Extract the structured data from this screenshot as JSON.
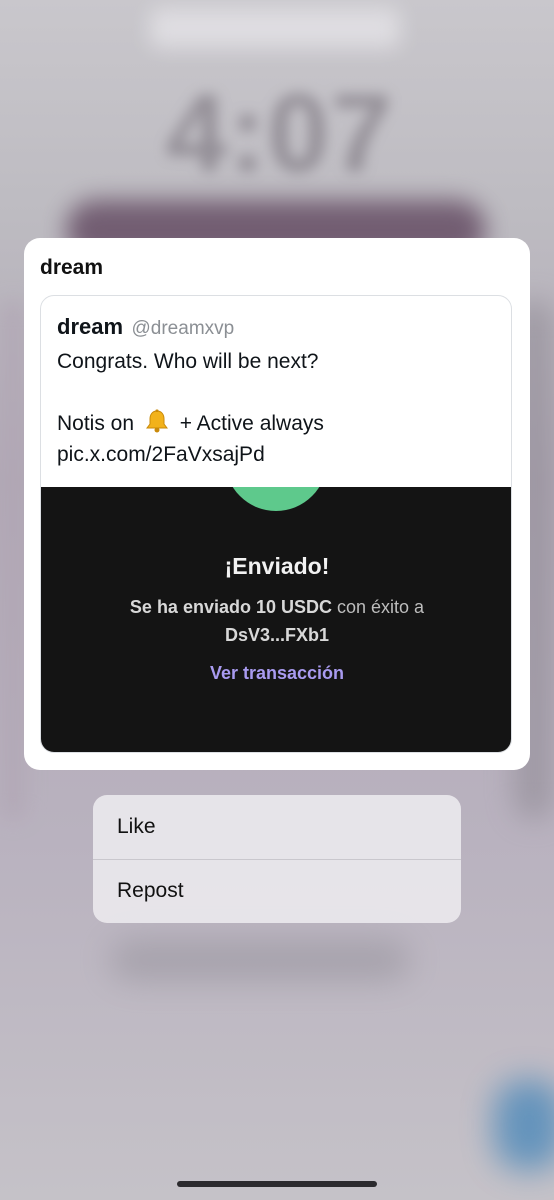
{
  "background": {
    "clock_time": "4:07"
  },
  "preview": {
    "title": "dream",
    "tweet": {
      "author_name": "dream",
      "author_handle": "@dreamxvp",
      "line1": "Congrats. Who will be next?",
      "line2_before_icon": "Notis on",
      "line2_icon": "bell-icon",
      "line2_after_icon": "+ Active always",
      "line3": "pic.x.com/2FaVxsajPd",
      "media": {
        "title": "¡Enviado!",
        "message_bold": "Se ha enviado 10 USDC",
        "message_rest": "con éxito a",
        "recipient": "DsV3...FXb1",
        "link": "Ver transacción",
        "accent_green": "#5ec98c",
        "link_color": "#a99bf0"
      }
    }
  },
  "menu": {
    "items": [
      {
        "label": "Like"
      },
      {
        "label": "Repost"
      }
    ]
  }
}
